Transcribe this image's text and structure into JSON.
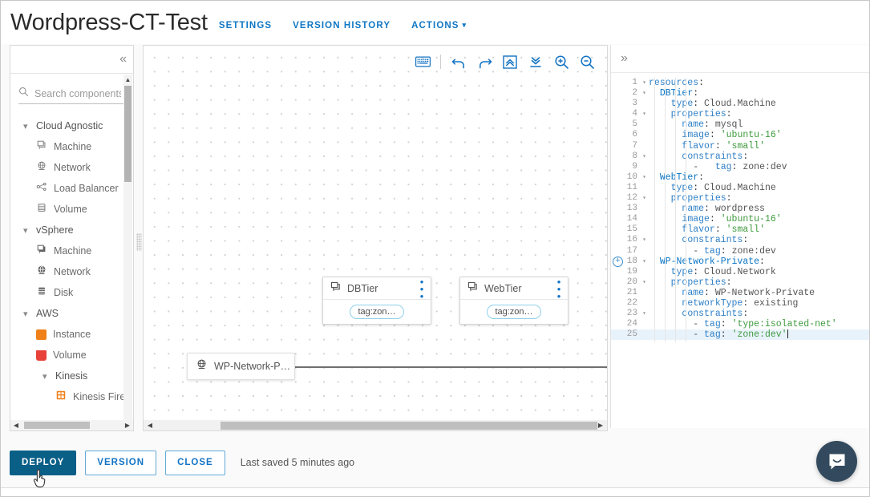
{
  "header": {
    "title": "Wordpress-CT-Test",
    "tabs": [
      {
        "label": "SETTINGS",
        "name": "tab-settings"
      },
      {
        "label": "VERSION HISTORY",
        "name": "tab-version-history"
      },
      {
        "label": "ACTIONS",
        "name": "tab-actions",
        "caret": "⌄"
      }
    ]
  },
  "left_panel": {
    "collapse_icon": "«",
    "search": {
      "placeholder": "Search components",
      "value": "",
      "icon": "search-icon"
    },
    "tree": [
      {
        "type": "group",
        "label": "Cloud Agnostic",
        "expanded": true,
        "chevron": "∨"
      },
      {
        "type": "item",
        "label": "Machine",
        "icon": "machine-icon"
      },
      {
        "type": "item",
        "label": "Network",
        "icon": "network-icon"
      },
      {
        "type": "item",
        "label": "Load Balancer",
        "icon": "load-balancer-icon"
      },
      {
        "type": "item",
        "label": "Volume",
        "icon": "volume-icon"
      },
      {
        "type": "group",
        "label": "vSphere",
        "expanded": true,
        "chevron": "∨"
      },
      {
        "type": "item",
        "label": "Machine",
        "icon": "machine-icon"
      },
      {
        "type": "item",
        "label": "Network",
        "icon": "network-icon"
      },
      {
        "type": "item",
        "label": "Disk",
        "icon": "disk-icon"
      },
      {
        "type": "group",
        "label": "AWS",
        "expanded": true,
        "chevron": "∨"
      },
      {
        "type": "item",
        "label": "Instance",
        "icon": "aws-instance-icon",
        "color": "#f08019"
      },
      {
        "type": "item",
        "label": "Volume",
        "icon": "aws-volume-icon",
        "color": "#e8413a"
      },
      {
        "type": "subgroup",
        "label": "Kinesis",
        "expanded": true,
        "chevron": "∨"
      },
      {
        "type": "deepitem",
        "label": "Kinesis Fire",
        "icon": "kinesis-firehose-icon",
        "color": "#f08019"
      }
    ]
  },
  "canvas": {
    "toolbar": [
      {
        "name": "keyboard-shortcuts-icon",
        "label": "keyboard"
      },
      {
        "name": "toolbar-separator",
        "label": "separator"
      },
      {
        "name": "undo-icon",
        "label": "undo"
      },
      {
        "name": "redo-icon",
        "label": "redo"
      },
      {
        "name": "expand-all-icon",
        "label": "expand all"
      },
      {
        "name": "collapse-all-icon",
        "label": "collapse all"
      },
      {
        "name": "zoom-in-icon",
        "label": "zoom in"
      },
      {
        "name": "zoom-out-icon",
        "label": "zoom out"
      }
    ],
    "nodes": [
      {
        "id": "dbtier",
        "title": "DBTier",
        "chip": "tag:zon…",
        "icon": "machine-icon",
        "kebab": "⋮"
      },
      {
        "id": "webtier",
        "title": "WebTier",
        "chip": "tag:zon…",
        "icon": "machine-icon",
        "kebab": "⋮"
      }
    ],
    "network_node": {
      "id": "wp-network",
      "title": "WP-Network-P…",
      "icon": "network-icon"
    }
  },
  "code_panel": {
    "expand_icon": "»",
    "highlighted_line": 25,
    "plus_marker_line": 18,
    "lines": [
      {
        "n": 1,
        "fold": "▾",
        "indent": 0,
        "tokens": [
          {
            "t": "resources",
            "c": "k"
          },
          {
            "t": ":",
            "c": "p"
          }
        ]
      },
      {
        "n": 2,
        "fold": "▾",
        "indent": 2,
        "tokens": [
          {
            "t": "DBTier",
            "c": "c"
          },
          {
            "t": ":",
            "c": "p"
          }
        ]
      },
      {
        "n": 3,
        "fold": "",
        "indent": 4,
        "tokens": [
          {
            "t": "type",
            "c": "k"
          },
          {
            "t": ": ",
            "c": "p"
          },
          {
            "t": "Cloud.Machine",
            "c": "g"
          }
        ]
      },
      {
        "n": 4,
        "fold": "▾",
        "indent": 4,
        "tokens": [
          {
            "t": "properties",
            "c": "k"
          },
          {
            "t": ":",
            "c": "p"
          }
        ]
      },
      {
        "n": 5,
        "fold": "",
        "indent": 6,
        "tokens": [
          {
            "t": "name",
            "c": "k"
          },
          {
            "t": ": ",
            "c": "p"
          },
          {
            "t": "mysql",
            "c": "g"
          }
        ]
      },
      {
        "n": 6,
        "fold": "",
        "indent": 6,
        "tokens": [
          {
            "t": "image",
            "c": "k"
          },
          {
            "t": ": ",
            "c": "p"
          },
          {
            "t": "'ubuntu-16'",
            "c": "s"
          }
        ]
      },
      {
        "n": 7,
        "fold": "",
        "indent": 6,
        "tokens": [
          {
            "t": "flavor",
            "c": "k"
          },
          {
            "t": ": ",
            "c": "p"
          },
          {
            "t": "'small'",
            "c": "s"
          }
        ]
      },
      {
        "n": 8,
        "fold": "▾",
        "indent": 6,
        "tokens": [
          {
            "t": "constraints",
            "c": "k"
          },
          {
            "t": ":",
            "c": "p"
          }
        ]
      },
      {
        "n": 9,
        "fold": "",
        "indent": 8,
        "tokens": [
          {
            "t": "-   ",
            "c": "g"
          },
          {
            "t": "tag",
            "c": "k"
          },
          {
            "t": ": ",
            "c": "p"
          },
          {
            "t": "zone:dev",
            "c": "g"
          }
        ]
      },
      {
        "n": 10,
        "fold": "▾",
        "indent": 2,
        "tokens": [
          {
            "t": "WebTier",
            "c": "c"
          },
          {
            "t": ":",
            "c": "p"
          }
        ]
      },
      {
        "n": 11,
        "fold": "",
        "indent": 4,
        "tokens": [
          {
            "t": "type",
            "c": "k"
          },
          {
            "t": ": ",
            "c": "p"
          },
          {
            "t": "Cloud.Machine",
            "c": "g"
          }
        ]
      },
      {
        "n": 12,
        "fold": "▾",
        "indent": 4,
        "tokens": [
          {
            "t": "properties",
            "c": "k"
          },
          {
            "t": ":",
            "c": "p"
          }
        ]
      },
      {
        "n": 13,
        "fold": "",
        "indent": 6,
        "tokens": [
          {
            "t": "name",
            "c": "k"
          },
          {
            "t": ": ",
            "c": "p"
          },
          {
            "t": "wordpress",
            "c": "g"
          }
        ]
      },
      {
        "n": 14,
        "fold": "",
        "indent": 6,
        "tokens": [
          {
            "t": "image",
            "c": "k"
          },
          {
            "t": ": ",
            "c": "p"
          },
          {
            "t": "'ubuntu-16'",
            "c": "s"
          }
        ]
      },
      {
        "n": 15,
        "fold": "",
        "indent": 6,
        "tokens": [
          {
            "t": "flavor",
            "c": "k"
          },
          {
            "t": ": ",
            "c": "p"
          },
          {
            "t": "'small'",
            "c": "s"
          }
        ]
      },
      {
        "n": 16,
        "fold": "▾",
        "indent": 6,
        "tokens": [
          {
            "t": "constraints",
            "c": "k"
          },
          {
            "t": ":",
            "c": "p"
          }
        ]
      },
      {
        "n": 17,
        "fold": "",
        "indent": 8,
        "tokens": [
          {
            "t": "- ",
            "c": "g"
          },
          {
            "t": "tag",
            "c": "k"
          },
          {
            "t": ": ",
            "c": "p"
          },
          {
            "t": "zone:dev",
            "c": "g"
          }
        ]
      },
      {
        "n": 18,
        "fold": "▾",
        "indent": 2,
        "tokens": [
          {
            "t": "WP-Network-Private",
            "c": "c"
          },
          {
            "t": ":",
            "c": "p"
          }
        ]
      },
      {
        "n": 19,
        "fold": "",
        "indent": 4,
        "tokens": [
          {
            "t": "type",
            "c": "k"
          },
          {
            "t": ": ",
            "c": "p"
          },
          {
            "t": "Cloud.Network",
            "c": "g"
          }
        ]
      },
      {
        "n": 20,
        "fold": "▾",
        "indent": 4,
        "tokens": [
          {
            "t": "properties",
            "c": "k"
          },
          {
            "t": ":",
            "c": "p"
          }
        ]
      },
      {
        "n": 21,
        "fold": "",
        "indent": 6,
        "tokens": [
          {
            "t": "name",
            "c": "k"
          },
          {
            "t": ": ",
            "c": "p"
          },
          {
            "t": "WP-Network-Private",
            "c": "g"
          }
        ]
      },
      {
        "n": 22,
        "fold": "",
        "indent": 6,
        "tokens": [
          {
            "t": "networkType",
            "c": "k"
          },
          {
            "t": ": ",
            "c": "p"
          },
          {
            "t": "existing",
            "c": "g"
          }
        ]
      },
      {
        "n": 23,
        "fold": "▾",
        "indent": 6,
        "tokens": [
          {
            "t": "constraints",
            "c": "k"
          },
          {
            "t": ":",
            "c": "p"
          }
        ]
      },
      {
        "n": 24,
        "fold": "",
        "indent": 8,
        "tokens": [
          {
            "t": "- ",
            "c": "g"
          },
          {
            "t": "tag",
            "c": "k"
          },
          {
            "t": ": ",
            "c": "p"
          },
          {
            "t": "'type:isolated-net'",
            "c": "s"
          }
        ]
      },
      {
        "n": 25,
        "fold": "",
        "indent": 8,
        "tokens": [
          {
            "t": "- ",
            "c": "g"
          },
          {
            "t": "tag",
            "c": "k"
          },
          {
            "t": ": ",
            "c": "p"
          },
          {
            "t": "'zone:dev'",
            "c": "s"
          }
        ]
      }
    ]
  },
  "footer": {
    "deploy_label": "DEPLOY",
    "version_label": "VERSION",
    "close_label": "CLOSE",
    "saved_text": "Last saved 5 minutes ago"
  },
  "chat": {
    "icon": "chat-bubble-icon"
  },
  "colors": {
    "accent_blue": "#1273c4",
    "primary_button": "#0a5f87",
    "code_key": "#2f80c7",
    "code_string": "#3f9a3f",
    "chip_border": "#8fd0ea",
    "aws_orange": "#f08019",
    "aws_red": "#e8413a",
    "chat_navy": "#334a5e"
  }
}
